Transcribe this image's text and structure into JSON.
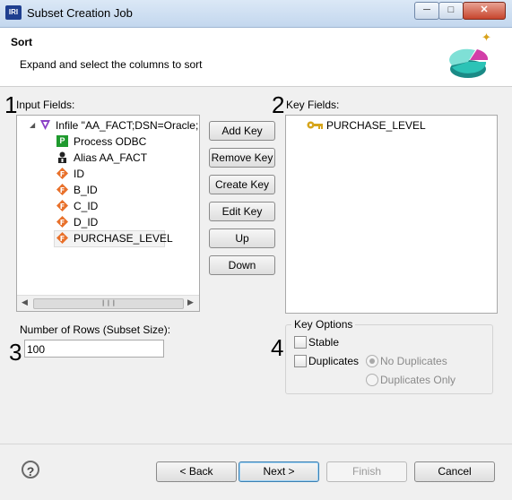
{
  "window": {
    "title": "Subset Creation Job",
    "app_icon": "IRI"
  },
  "header": {
    "title": "Sort",
    "description": "Expand and select the columns to sort"
  },
  "annotations": {
    "n1": "1",
    "n2": "2",
    "n3": "3",
    "n4": "4"
  },
  "input_fields": {
    "label": "Input Fields:",
    "root": {
      "label": "Infile \"AA_FACT;DSN=Oracle;",
      "icon": "triangle-down-icon"
    },
    "items": [
      {
        "label": "Process ODBC",
        "icon": "process-p-icon"
      },
      {
        "label": "Alias AA_FACT",
        "icon": "alias-user-icon"
      },
      {
        "label": "ID",
        "icon": "field-f-icon"
      },
      {
        "label": "B_ID",
        "icon": "field-f-icon"
      },
      {
        "label": "C_ID",
        "icon": "field-f-icon"
      },
      {
        "label": "D_ID",
        "icon": "field-f-icon"
      },
      {
        "label": "PURCHASE_LEVEL",
        "icon": "field-f-icon"
      }
    ]
  },
  "buttons": {
    "add_key": "Add Key",
    "remove_key": "Remove Key",
    "create_key": "Create Key",
    "edit_key": "Edit Key",
    "up": "Up",
    "down": "Down"
  },
  "key_fields": {
    "label": "Key Fields:",
    "items": [
      {
        "label": "PURCHASE_LEVEL",
        "icon": "key-icon"
      }
    ]
  },
  "rows": {
    "label": "Number of Rows (Subset Size):",
    "value": "100"
  },
  "key_options": {
    "legend": "Key Options",
    "stable": {
      "label": "Stable",
      "checked": false
    },
    "duplicates": {
      "label": "Duplicates",
      "checked": false
    },
    "no_duplicates": {
      "label": "No Duplicates",
      "selected": true,
      "enabled": false
    },
    "duplicates_only": {
      "label": "Duplicates Only",
      "selected": false,
      "enabled": false
    }
  },
  "footer": {
    "back": "< Back",
    "next": "Next >",
    "finish": "Finish",
    "cancel": "Cancel"
  },
  "colors": {
    "field_icon": "#e8702a",
    "process_icon": "#1f9a2e",
    "infile_icon": "#8a3fc6",
    "key_icon": "#d6a51c"
  }
}
